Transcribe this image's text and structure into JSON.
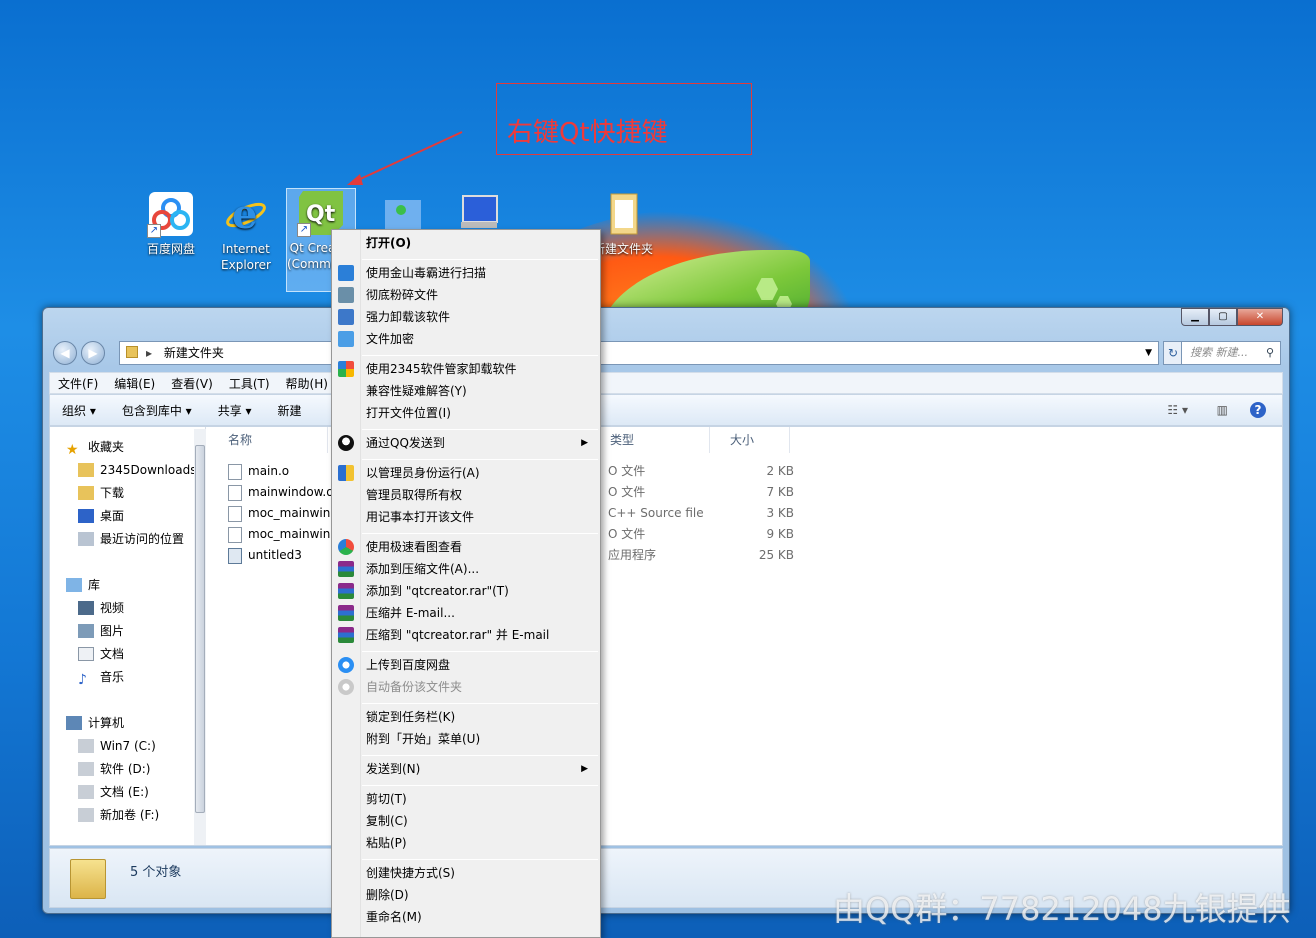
{
  "annotation": {
    "text": "右键Qt快捷键"
  },
  "desktop_icons": [
    {
      "label": "百度网盘"
    },
    {
      "label": "Internet Explorer"
    },
    {
      "label": "Qt Creator (Community)"
    },
    {
      "label": ""
    },
    {
      "label": ""
    },
    {
      "label": "新建文件夹"
    }
  ],
  "explorer": {
    "address": "新建文件夹",
    "search_placeholder": "搜索 新建...",
    "menu": [
      "文件(F)",
      "编辑(E)",
      "查看(V)",
      "工具(T)",
      "帮助(H)"
    ],
    "toolbar": [
      "组织 ▾",
      "包含到库中 ▾",
      "共享 ▾",
      "新建"
    ],
    "nav": {
      "favorites": "收藏夹",
      "fav_items": [
        "2345Downloads",
        "下载",
        "桌面",
        "最近访问的位置"
      ],
      "libraries": "库",
      "lib_items": [
        "视频",
        "图片",
        "文档",
        "音乐"
      ],
      "computer": "计算机",
      "drives": [
        "Win7 (C:)",
        "软件 (D:)",
        "文档 (E:)",
        "新加卷 (F:)"
      ]
    },
    "columns": {
      "name": "名称",
      "type": "类型",
      "size": "大小"
    },
    "files": [
      {
        "name": "main.o",
        "type": "O 文件",
        "size": "2 KB"
      },
      {
        "name": "mainwindow.o",
        "type": "O 文件",
        "size": "7 KB"
      },
      {
        "name": "moc_mainwindow.cpp",
        "type": "C++ Source file",
        "size": "3 KB"
      },
      {
        "name": "moc_mainwindow.o",
        "type": "O 文件",
        "size": "9 KB"
      },
      {
        "name": "untitled3",
        "type": "应用程序",
        "size": "25 KB"
      }
    ],
    "status": "5 个对象"
  },
  "context_menu": {
    "open": "打开(O)",
    "g1": [
      "使用金山毒霸进行扫描",
      "彻底粉碎文件",
      "强力卸载该软件",
      "文件加密"
    ],
    "g2": [
      "使用2345软件管家卸载软件",
      "兼容性疑难解答(Y)",
      "打开文件位置(I)"
    ],
    "qq_send": "通过QQ发送到",
    "g3": [
      "以管理员身份运行(A)",
      "管理员取得所有权",
      "用记事本打开该文件"
    ],
    "g4": [
      "使用极速看图查看",
      "添加到压缩文件(A)...",
      "添加到 \"qtcreator.rar\"(T)",
      "压缩并 E-mail...",
      "压缩到 \"qtcreator.rar\" 并 E-mail"
    ],
    "g5": [
      "上传到百度网盘",
      "自动备份该文件夹"
    ],
    "g6": [
      "锁定到任务栏(K)",
      "附到「开始」菜单(U)"
    ],
    "send_to": "发送到(N)",
    "g7": [
      "剪切(T)",
      "复制(C)",
      "粘贴(P)"
    ],
    "g8": [
      "创建快捷方式(S)",
      "删除(D)",
      "重命名(M)"
    ]
  },
  "watermark": "由QQ群：778212048九银提供"
}
